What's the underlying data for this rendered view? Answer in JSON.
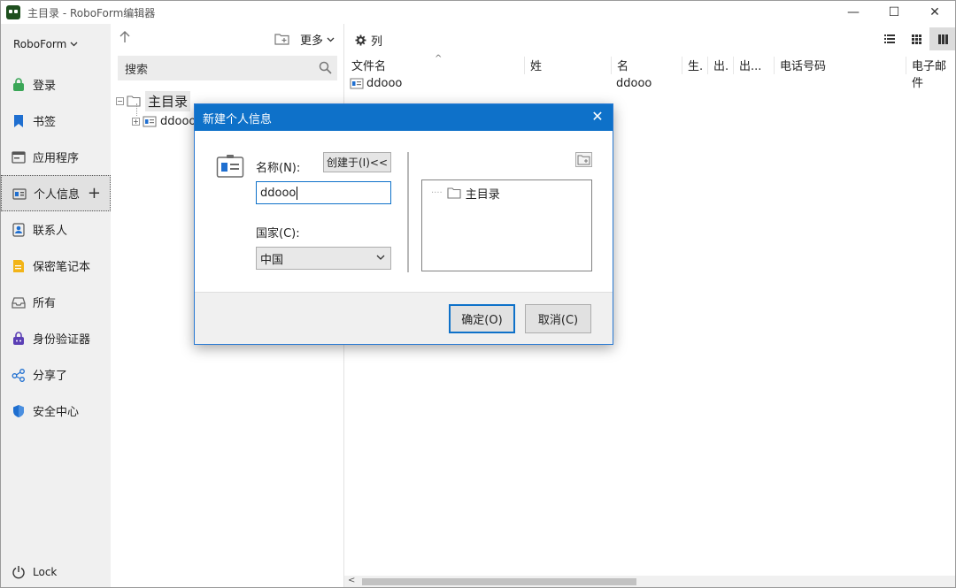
{
  "window": {
    "title": "主目录 - RoboForm编辑器",
    "minimize": "—",
    "maximize": "☐",
    "close": "✕"
  },
  "leftnav": {
    "account": "RoboForm",
    "items": [
      {
        "label": "登录",
        "icon": "login-icon",
        "color": "#3aa657"
      },
      {
        "label": "书签",
        "icon": "bookmark-icon",
        "color": "#1f6fd0"
      },
      {
        "label": "应用程序",
        "icon": "application-icon",
        "color": "#555555"
      },
      {
        "label": "个人信息",
        "icon": "identity-icon",
        "color": "#1f6fd0",
        "active": true
      },
      {
        "label": "联系人",
        "icon": "contact-icon",
        "color": "#1f6fd0"
      },
      {
        "label": "保密笔记本",
        "icon": "safenote-icon",
        "color": "#f2b418"
      },
      {
        "label": "所有",
        "icon": "all-items-icon",
        "color": "#666666"
      },
      {
        "label": "身份验证器",
        "icon": "authenticator-icon",
        "color": "#5b3fb5"
      },
      {
        "label": "分享了",
        "icon": "share-icon",
        "color": "#1f6fd0"
      },
      {
        "label": "安全中心",
        "icon": "security-center-icon",
        "color": "#1f6fd0"
      }
    ],
    "add_symbol": "+",
    "lock": "Lock"
  },
  "treepanel": {
    "more": "更多",
    "search_placeholder": "搜索",
    "root": "主目录",
    "child": "ddooo"
  },
  "content": {
    "columns_btn": "列",
    "headers": [
      "文件名",
      "姓",
      "名",
      "生.",
      "出.",
      "出...",
      "电话号码",
      "电子邮件"
    ],
    "rows": [
      {
        "filename": "ddooo",
        "last": "",
        "first": "ddooo"
      }
    ]
  },
  "dialog": {
    "title": "新建个人信息",
    "name_label": "名称(N):",
    "create_in_btn": "创建于(I)<<",
    "name_value": "ddooo",
    "country_label": "国家(C):",
    "country_value": "中国",
    "folder_root": "主目录",
    "ok": "确定(O)",
    "cancel": "取消(C)"
  },
  "colors": {
    "accent": "#0e71c9",
    "nav_bg": "#f0f0f0"
  }
}
